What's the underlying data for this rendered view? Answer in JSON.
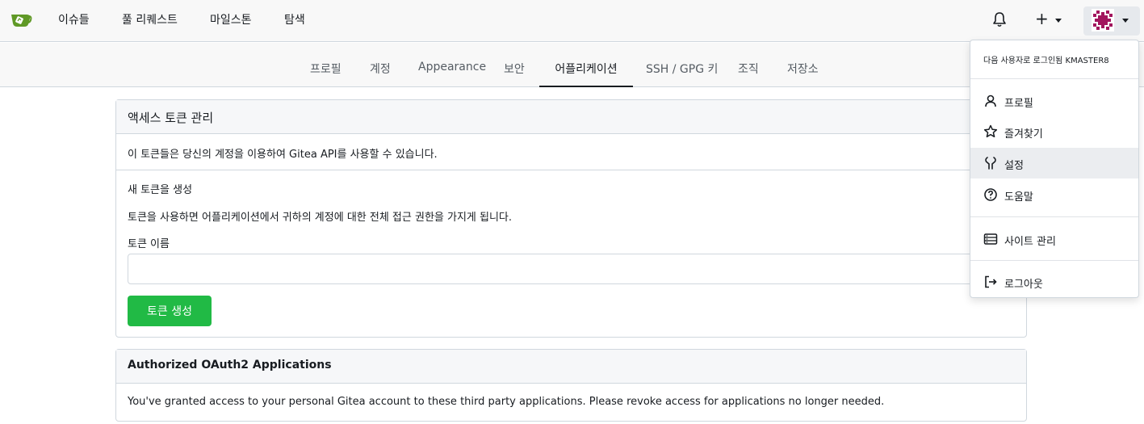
{
  "navbar": {
    "links": [
      "이슈들",
      "풀 리퀘스트",
      "마일스톤",
      "탐색"
    ],
    "plus_label": "+"
  },
  "settings_tabs": {
    "items": [
      "프로필",
      "계정",
      "Appearance",
      "보안",
      "어플리케이션",
      "SSH / GPG 키",
      "조직",
      "저장소"
    ],
    "active": "어플리케이션"
  },
  "access_tokens": {
    "header": "액세스 토큰 관리",
    "description": "이 토큰들은 당신의 계정을 이용하여 Gitea API를 사용할 수 있습니다.",
    "new_token_title": "새 토큰을 생성",
    "new_token_warning": "토큰을 사용하면 어플리케이션에서 귀하의 계정에 대한 전체 접근 권한을 가지게 됩니다.",
    "token_name_label": "토큰 이름",
    "token_name_value": "",
    "generate_button": "토큰 생성"
  },
  "oauth": {
    "header": "Authorized OAuth2 Applications",
    "description": "You've granted access to your personal Gitea account to these third party applications. Please revoke access for applications no longer needed."
  },
  "user_menu": {
    "signed_in_as": "다음 사용자로 로그인됨 KMASTER8",
    "items": [
      {
        "label": "프로필",
        "icon": "person-icon"
      },
      {
        "label": "즐겨찾기",
        "icon": "star-icon"
      },
      {
        "label": "설정",
        "icon": "tools-icon"
      },
      {
        "label": "도움말",
        "icon": "question-icon"
      },
      {
        "label": "사이트 관리",
        "icon": "server-icon"
      },
      {
        "label": "로그아웃",
        "icon": "sign-out-icon"
      }
    ],
    "highlighted": "설정"
  },
  "colors": {
    "primary_green": "#21ba45",
    "logo_green": "#609926",
    "avatar_magenta": "#a2155e"
  }
}
